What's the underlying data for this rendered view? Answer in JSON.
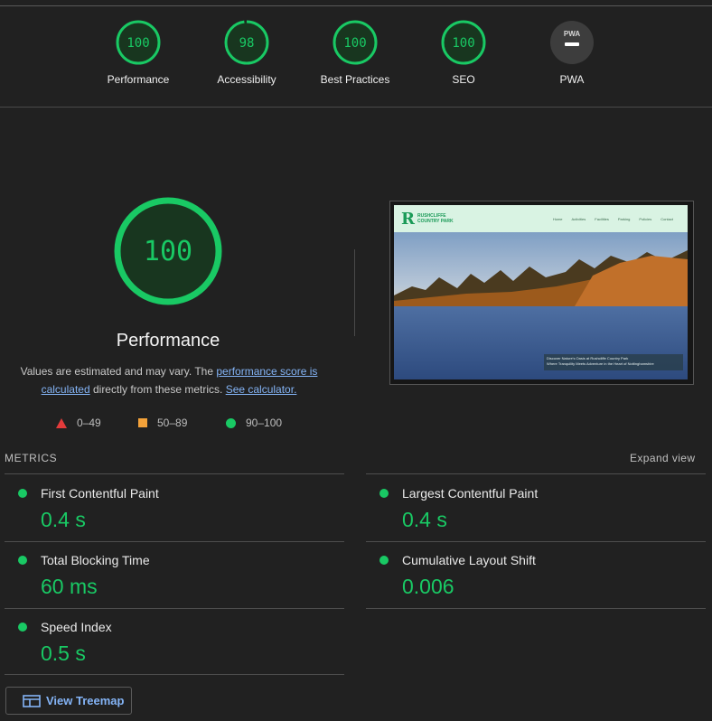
{
  "colors": {
    "pass": "#19c964",
    "average": "#f4a23a",
    "fail": "#e33b3b",
    "link": "#84b4f6",
    "background": "#212121"
  },
  "categories": [
    {
      "label": "Performance",
      "score": "100",
      "value": 100
    },
    {
      "label": "Accessibility",
      "score": "98",
      "value": 98
    },
    {
      "label": "Best Practices",
      "score": "100",
      "value": 100
    },
    {
      "label": "SEO",
      "score": "100",
      "value": 100
    },
    {
      "label": "PWA",
      "badge": "PWA",
      "icon": "pwa-dash-icon"
    }
  ],
  "performance": {
    "score": "100",
    "value": 100,
    "title": "Performance",
    "desc_prefix": "Values are estimated and may vary. The ",
    "desc_link1": "performance score is calculated",
    "desc_middle": " directly from these metrics. ",
    "desc_link2": "See calculator."
  },
  "legend": {
    "fail": "0–49",
    "average": "50–89",
    "pass": "90–100"
  },
  "screenshot": {
    "site_logo": "R",
    "site_name": "RUSHCLIFFE COUNTRY PARK",
    "nav": [
      "Home",
      "Activities",
      "Facilities",
      "Parking",
      "Policies",
      "Contact"
    ],
    "caption_line1": "Discover Nature's Oasis at Rushcliffe Country Park",
    "caption_line2": "Where Tranquility Meets Adventure in the Heart of Nottinghamshire"
  },
  "metrics": {
    "heading": "METRICS",
    "expand_label": "Expand view",
    "items": [
      {
        "name": "First Contentful Paint",
        "value": "0.4 s"
      },
      {
        "name": "Largest Contentful Paint",
        "value": "0.4 s"
      },
      {
        "name": "Total Blocking Time",
        "value": "60 ms"
      },
      {
        "name": "Cumulative Layout Shift",
        "value": "0.006"
      },
      {
        "name": "Speed Index",
        "value": "0.5 s"
      }
    ]
  },
  "treemap": {
    "label": "View Treemap",
    "icon": "treemap-icon"
  }
}
